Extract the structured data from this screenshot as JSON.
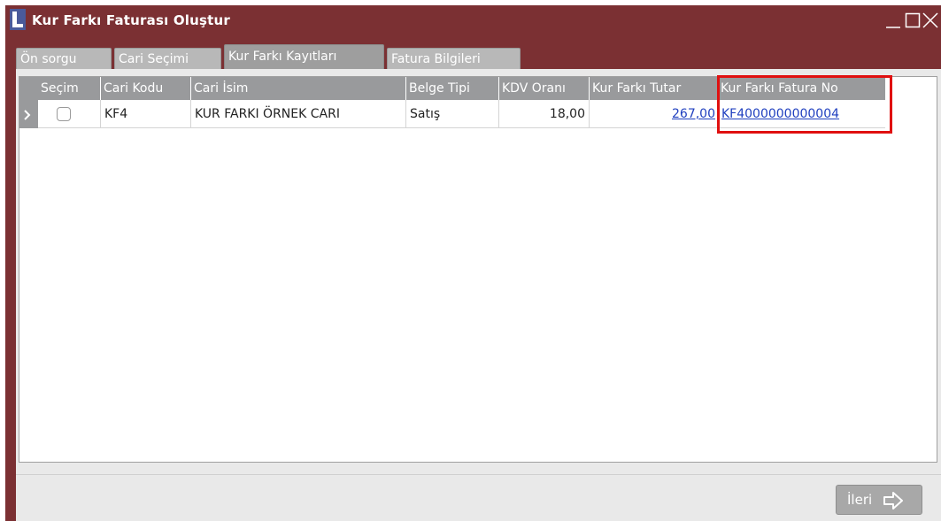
{
  "window": {
    "title": "Kur Farkı Faturası Oluştur",
    "app_icon": "L-logo-icon",
    "controls": [
      "minimize-icon",
      "maximize-icon",
      "close-icon"
    ]
  },
  "tabs": [
    {
      "label": "Ön sorgu",
      "active": false
    },
    {
      "label": "Cari Seçimi",
      "active": false
    },
    {
      "label": "Kur Farkı Kayıtları",
      "active": true
    },
    {
      "label": "Fatura Bilgileri",
      "active": false
    }
  ],
  "grid": {
    "columns": [
      "Seçim",
      "Cari Kodu",
      "Cari İsim",
      "Belge Tipi",
      "KDV Oranı",
      "Kur Farkı Tutar",
      "Kur Farkı Fatura No"
    ],
    "rows": [
      {
        "selected": false,
        "cari_kodu": "KF4",
        "cari_isim": "KUR FARKI ÖRNEK CARI",
        "belge_tipi": "Satış",
        "kdv_orani": "18,00",
        "kur_farki_tutar": "267,00",
        "kur_farki_fatura_no": "KF4000000000004"
      }
    ]
  },
  "footer": {
    "next_label": "İleri",
    "next_icon": "arrow-right-outline-icon"
  },
  "colors": {
    "window_frame": "#7b3033",
    "header_bg": "#999a9c",
    "highlight_border": "#e01010",
    "link": "#1f3fbf"
  }
}
